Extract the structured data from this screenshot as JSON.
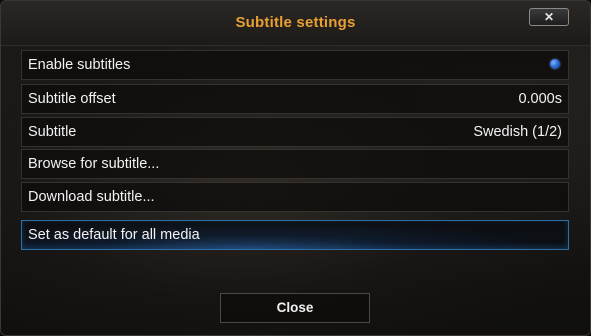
{
  "dialog": {
    "title": "Subtitle settings",
    "close_glyph": "✕",
    "close_icon": "close-icon"
  },
  "rows": [
    {
      "label": "Enable subtitles",
      "value": "",
      "control": "radio-button-on"
    },
    {
      "label": "Subtitle offset",
      "value": "0.000s"
    },
    {
      "label": "Subtitle",
      "value": "Swedish (1/2)"
    },
    {
      "label": "Browse for subtitle...",
      "value": ""
    },
    {
      "label": "Download subtitle...",
      "value": ""
    },
    {
      "label": "Set as default for all media",
      "value": "",
      "focused": true
    }
  ],
  "footer": {
    "close_label": "Close"
  },
  "colors": {
    "title": "#e8a033",
    "focus_accent": "#2d6fa8",
    "radio_on": "#2f6fd9"
  }
}
